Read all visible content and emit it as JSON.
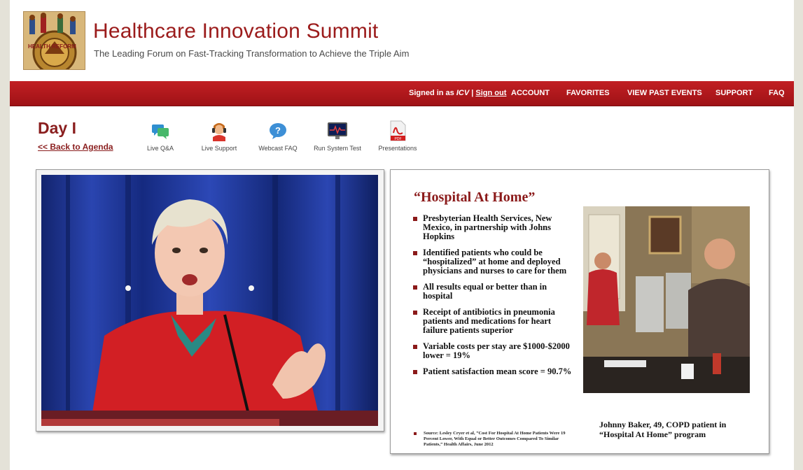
{
  "header": {
    "logo_text": "HEALTH REFORM",
    "title": "Healthcare Innovation Summit",
    "tagline": "The Leading Forum on Fast-Tracking Transformation to Achieve the Triple Aim"
  },
  "nav": {
    "signed_in_prefix": "Signed in as ",
    "user": "ICV",
    "separator": " | ",
    "sign_out": "Sign out",
    "items": [
      "ACCOUNT",
      "FAVORITES",
      "VIEW PAST EVENTS",
      "SUPPORT",
      "FAQ"
    ]
  },
  "day": {
    "title": "Day I",
    "back_link": "<< Back to Agenda"
  },
  "tools": [
    {
      "label": "Live Q&A",
      "icon": "chat-bubbles-icon"
    },
    {
      "label": "Live Support",
      "icon": "headset-agent-icon"
    },
    {
      "label": "Webcast FAQ",
      "icon": "help-bubble-icon"
    },
    {
      "label": "Run System Test",
      "icon": "monitor-pulse-icon"
    },
    {
      "label": "Presentations",
      "icon": "pdf-icon"
    }
  ],
  "slide": {
    "title": "“Hospital At Home”",
    "bullets": [
      "Presbyterian Health Services, New Mexico, in partnership with Johns Hopkins",
      "Identified patients who could be “hospitalized” at home and deployed physicians and nurses to care for them",
      "All results equal or better than in hospital",
      "Receipt of antibiotics in pneumonia patients and medications for heart failure patients superior",
      "Variable costs per stay are $1000-$2000 lower = 19%",
      "Patient satisfaction mean score = 90.7%"
    ],
    "source": "Source: Lesley Cryer et al, “Cost For Hospital At Home Patients Were 19 Percent Lower, With Equal or Better Outcomes Compared To Similar Patients,” Health Affairs, June 2012",
    "caption": "Johnny Baker, 49, COPD patient in “Hospital At Home” program"
  },
  "colors": {
    "brand_red": "#9b1b1b",
    "nav_red": "#b2181c",
    "slide_accent": "#8b1a1a"
  }
}
